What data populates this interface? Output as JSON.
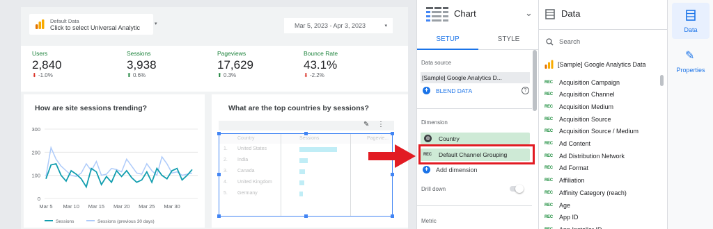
{
  "report": {
    "data_source_title": "Default Data",
    "data_source_sub": "Click to select Universal Analytic",
    "date_range": "Mar 5, 2023 - Apr 3, 2023",
    "kpis": [
      {
        "label": "Users",
        "value": "2,840",
        "delta": "-1.0%",
        "dir": "down"
      },
      {
        "label": "Sessions",
        "value": "3,938",
        "delta": "0.6%",
        "dir": "up"
      },
      {
        "label": "Pageviews",
        "value": "17,629",
        "delta": "0.3%",
        "dir": "up"
      },
      {
        "label": "Bounce Rate",
        "value": "43.1%",
        "delta": "-2.2%",
        "dir": "down"
      }
    ],
    "trend_title": "How are site sessions trending?",
    "countries_title": "What are the top countries by sessions?",
    "table_headers": [
      "Country",
      "Sessions",
      "Pagevie..."
    ],
    "table_rows": [
      "United States",
      "India",
      "Canada",
      "United Kingdom",
      "Germany"
    ],
    "table_bars": [
      0.9,
      0.2,
      0.14,
      0.12,
      0.08
    ]
  },
  "chart_data": {
    "type": "line",
    "title": "How are site sessions trending?",
    "x_ticks": [
      "Mar 5",
      "Mar 10",
      "Mar 15",
      "Mar 20",
      "Mar 25",
      "Mar 30"
    ],
    "y_ticks": [
      "0",
      "100",
      "200",
      "300"
    ],
    "ylim": [
      0,
      300
    ],
    "legend_position": "bottom",
    "series": [
      {
        "name": "Sessions",
        "color": "#129eaf",
        "values": [
          85,
          145,
          150,
          100,
          75,
          120,
          105,
          85,
          50,
          130,
          115,
          60,
          95,
          70,
          120,
          95,
          120,
          90,
          70,
          80,
          115,
          70,
          130,
          100,
          85,
          120,
          130,
          80,
          100,
          125
        ]
      },
      {
        "name": "Sessions (previous 30 days)",
        "color": "#aecbfa",
        "values": [
          95,
          220,
          170,
          140,
          120,
          100,
          95,
          110,
          150,
          120,
          160,
          100,
          105,
          130,
          125,
          115,
          170,
          140,
          110,
          105,
          150,
          120,
          100,
          180,
          150,
          110,
          115,
          100,
          105,
          110
        ]
      }
    ]
  },
  "chart_panel": {
    "title": "Chart",
    "tab_setup": "SETUP",
    "tab_style": "STYLE",
    "data_source_label": "Data source",
    "data_source_value": "[Sample] Google Analytics D...",
    "blend_label": "BLEND DATA",
    "dimension_label": "Dimension",
    "dim1": "Country",
    "dim2": "Default Channel Grouping",
    "add_dimension": "Add dimension",
    "drill_down": "Drill down",
    "metric": "Metric"
  },
  "data_panel": {
    "title": "Data",
    "search_placeholder": "Search",
    "source_name": "[Sample] Google Analytics Data",
    "fields": [
      "Acquisition Campaign",
      "Acquisition Channel",
      "Acquisition Medium",
      "Acquisition Source",
      "Acquisition Source / Medium",
      "Ad Content",
      "Ad Distribution Network",
      "Ad Format",
      "Affiliation",
      "Affinity Category (reach)",
      "Age",
      "App ID",
      "App Installer ID"
    ],
    "field_type": "REC"
  },
  "rail": {
    "data_label": "Data",
    "properties_label": "Properties"
  },
  "colors": {
    "accent": "#1a73e8",
    "highlight": "#e21b23",
    "chip": "#ceead6",
    "teal": "#129eaf"
  }
}
